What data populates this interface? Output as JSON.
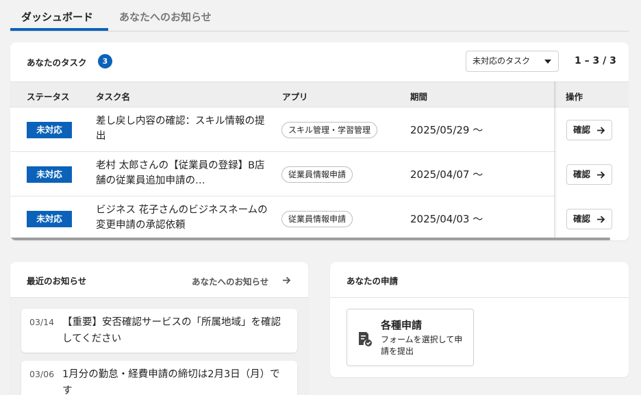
{
  "tabs": [
    {
      "label": "ダッシュボード",
      "active": true
    },
    {
      "label": "あなたへのお知らせ",
      "active": false
    }
  ],
  "tasks": {
    "title": "あなたのタスク",
    "count": "3",
    "filter": {
      "selected": "未対応のタスク"
    },
    "pager": "1 – 3 / 3",
    "columns": [
      "ステータス",
      "タスク名",
      "アプリ",
      "期間",
      "操作"
    ],
    "rows": [
      {
        "status": "未対応",
        "name": "差し戻し内容の確認：スキル情報の提出",
        "app": "スキル管理・学習管理",
        "period": "2025/05/29 〜",
        "action": "確認"
      },
      {
        "status": "未対応",
        "name": "老村 太郎さんの【従業員の登録】B店舗の従業員追加申請の…",
        "app": "従業員情報申請",
        "period": "2025/04/07 〜",
        "action": "確認"
      },
      {
        "status": "未対応",
        "name": "ビジネス 花子さんのビジネスネームの変更申請の承認依頼",
        "app": "従業員情報申請",
        "period": "2025/04/03 〜",
        "action": "確認"
      }
    ]
  },
  "notices": {
    "title": "最近のお知らせ",
    "link_label": "あなたへのお知らせ",
    "items": [
      {
        "date": "03/14",
        "text": "【重要】安否確認サービスの「所属地域」を確認してください"
      },
      {
        "date": "03/06",
        "text": "1月分の勤怠・経費申請の締切は2月3日（月）です"
      }
    ]
  },
  "applications": {
    "title": "あなたの申請",
    "tile": {
      "title": "各種申請",
      "description": "フォームを選択して申請を提出"
    }
  },
  "colors": {
    "accent": "#0b62b8",
    "background": "#f2f2f2"
  }
}
